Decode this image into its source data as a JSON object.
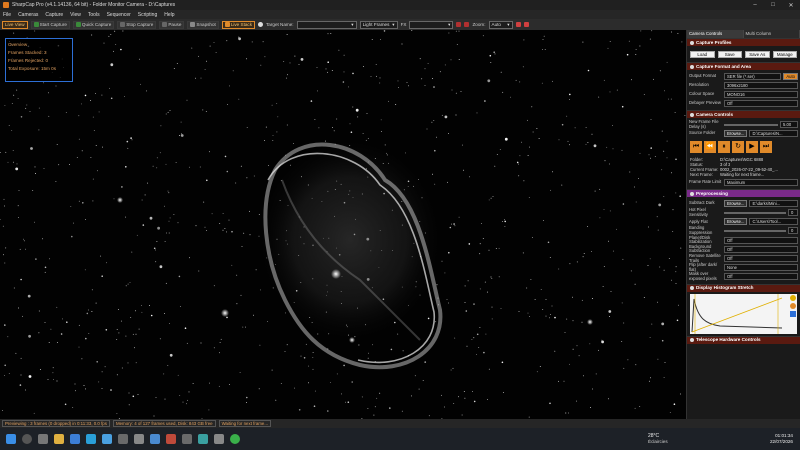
{
  "window": {
    "title": "SharpCap Pro (v4.1.14136, 64 bit) - Folder Monitor Camera - D:\\Captures",
    "buttons": [
      "–",
      "□",
      "✕"
    ]
  },
  "menu": [
    "File",
    "Cameras",
    "Capture",
    "View",
    "Tools",
    "Sequencer",
    "Scripting",
    "Help"
  ],
  "toolbar": {
    "live_view": "Live View",
    "start_capture": "Start Capture",
    "quick_capture": "Quick Capture",
    "stop_capture": "Stop Capture",
    "pause": "Pause",
    "snapshot": "Snapshot",
    "live_stack": "Live Stack",
    "target_label": "Target Name:",
    "target_value": "",
    "frames_value": "Light Frames",
    "fx_label": "FX",
    "fx_value": "",
    "zoom_label": "Zoom:",
    "zoom_value": "Auto"
  },
  "overview": {
    "title": "Overview",
    "stacked": "Frames Stacked: 3",
    "rejected": "Frames Rejected: 0",
    "exposure": "Total Exposure: 15m 0s"
  },
  "panel": {
    "tabs": [
      "Camera Controls",
      "Multi Column"
    ],
    "capture_profiles": {
      "header": "Capture Profiles",
      "buttons": [
        "Load",
        "Save",
        "Save As",
        "Manage"
      ]
    },
    "format_area": {
      "header": "Capture Format and Area",
      "output_label": "Output Format",
      "output_value": "SER file (*.ser)",
      "auto_label": "Auto",
      "resolution_label": "Resolution",
      "resolution_value": "3096x2180",
      "colour_label": "Colour Space",
      "colour_value": "MONO16",
      "debayer_label": "Debayer Preview",
      "debayer_value": "Off"
    },
    "camera_controls": {
      "header": "Camera Controls",
      "delay_label": "New Frame File Delay (s)",
      "delay_value": "5.00",
      "source_label": "Source Folder",
      "browse": "Browse...",
      "source_value": "D:\\Captures\\N...",
      "controls": [
        "⏮",
        "⏪",
        "⏸",
        "↻",
        "▶",
        "⏭"
      ],
      "info": [
        [
          "Folder:",
          "D:\\Captures\\NGC 6888"
        ],
        [
          "Status:",
          "3 of 3"
        ],
        [
          "Current Frame:",
          "0002_2026-07-22_09-52-40_..."
        ],
        [
          "Next Frame:",
          "Waiting for next frame..."
        ]
      ],
      "framerate_label": "Frame Rate Limit",
      "framerate_value": "Maximum"
    },
    "preprocessing": {
      "header": "Preprocessing",
      "dark_label": "Subtract Dark",
      "dark_browse": "Browse...",
      "dark_value": "E:\\darks\\Mini...",
      "hotpix_label": "Hot Pixel Sensitivity",
      "hotpix_value": "0",
      "flat_label": "Apply Flat",
      "flat_browse": "Browse...",
      "flat_value": "C:\\Users\\Tool...",
      "banding_label": "Banding Suppression",
      "banding_value": "0",
      "planet_label": "Planet/Disk Stabilization",
      "planet_value": "Off",
      "bg_label": "Background Subtraction",
      "bg_value": "Off",
      "sat_label": "Remove Satellite Trails",
      "sat_value": "Off",
      "flip_label": "Flip (after dark/ flat)",
      "flip_value": "None",
      "mask_label": "Mask over exposed pixels",
      "mask_value": "Off"
    },
    "histogram": {
      "header": "Display Histogram Stretch"
    },
    "telescope": {
      "header": "Telescope Hardware Controls"
    }
  },
  "statusbar": {
    "preview": "Previewing : 3 frames (0 dropped) in 0:11:33, 0.0 fps",
    "memory": "Memory: 4 of 127 frames used, Disk: 843 GB free",
    "waiting": "Waiting for next frame..."
  },
  "taskbar": {
    "temp": "28°C",
    "condition": "Éclaircies",
    "time": "01:01:34",
    "date": "22/07/2026"
  },
  "colors": {
    "accent": "#e08a2a",
    "panel_header": "#5a1a10",
    "preprocess_header": "#7a2a8a",
    "overview_border": "#2d6fd6"
  }
}
